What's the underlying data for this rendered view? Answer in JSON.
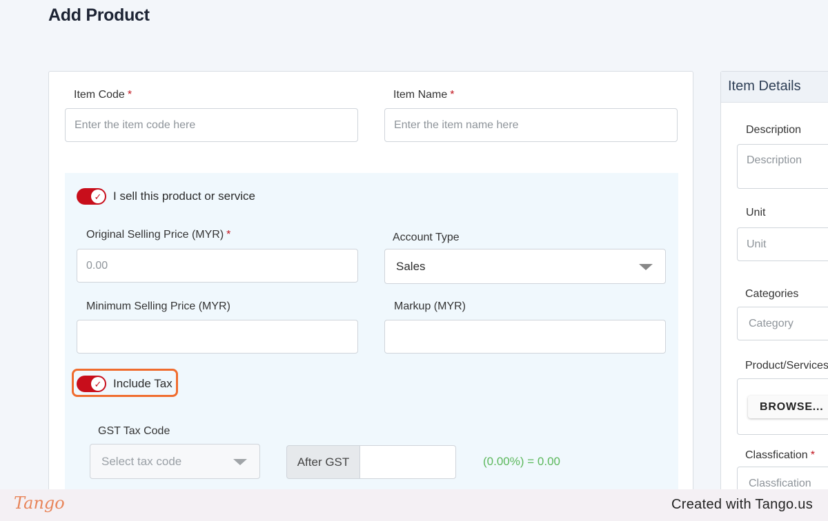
{
  "page": {
    "title": "Add Product"
  },
  "form": {
    "item_code": {
      "label": "Item Code",
      "required": "*",
      "placeholder": "Enter the item code here"
    },
    "item_name": {
      "label": "Item Name",
      "required": "*",
      "placeholder": "Enter the item name here"
    },
    "sell_toggle": {
      "label": "I sell this product or service",
      "checked": true
    },
    "original_price": {
      "label": "Original Selling Price (MYR)",
      "required": "*",
      "placeholder": "0.00"
    },
    "account_type": {
      "label": "Account Type",
      "value": "Sales"
    },
    "min_price": {
      "label": "Minimum Selling Price (MYR)",
      "value": ""
    },
    "markup": {
      "label": "Markup (MYR)",
      "value": ""
    },
    "include_tax": {
      "label": "Include Tax",
      "checked": true
    },
    "gst_tax_code": {
      "label": "GST Tax Code",
      "placeholder": "Select tax code"
    },
    "after_gst": {
      "label": "After GST",
      "value": ""
    },
    "gst_result": "(0.00%) = 0.00"
  },
  "item_details": {
    "title": "Item Details",
    "description": {
      "label": "Description",
      "placeholder": "Description"
    },
    "unit": {
      "label": "Unit",
      "placeholder": "Unit"
    },
    "categories": {
      "label": "Categories",
      "placeholder": "Category"
    },
    "product_services": {
      "label": "Product/Services",
      "button": "BROWSE..."
    },
    "classification": {
      "label": "Classfication",
      "required": "*",
      "placeholder": "Classfication"
    }
  },
  "footer": {
    "logo": "Tango",
    "credit": "Created with Tango.us"
  },
  "colors": {
    "accent_red": "#c80e1b",
    "highlight_orange": "#f06c2e",
    "success_green": "#5cb85c"
  }
}
